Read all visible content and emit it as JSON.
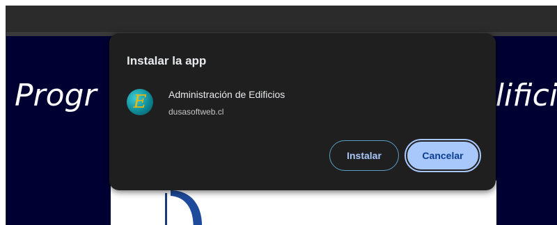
{
  "page": {
    "heading_left": "Progr",
    "heading_right": "lifici"
  },
  "dialog": {
    "title": "Instalar la app",
    "app_icon_glyph": "E",
    "app_name": "Administración de Edificios",
    "app_origin": "dusasoftweb.cl",
    "install_label": "Instalar",
    "cancel_label": "Cancelar"
  },
  "colors": {
    "page_background": "#000033",
    "dialog_background": "#1f1f1f",
    "primary_button": "#a8c7fa"
  }
}
